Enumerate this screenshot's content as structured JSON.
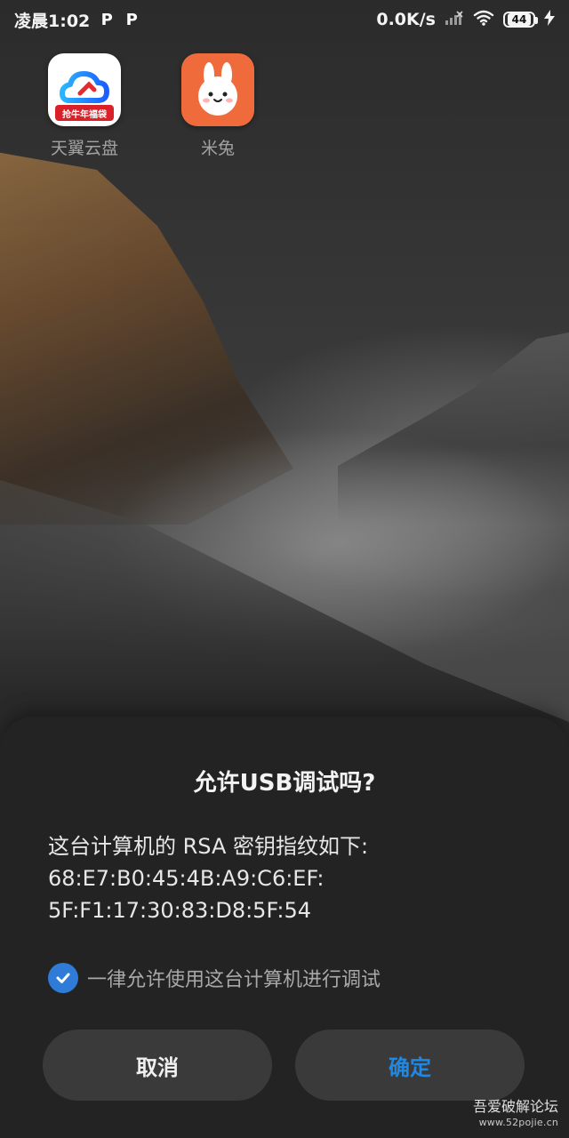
{
  "status_bar": {
    "time": "凌晨1:02",
    "left_icons": [
      "P",
      "P"
    ],
    "network_speed": "0.0K/s",
    "battery_level": "44"
  },
  "home_screen": {
    "apps": [
      {
        "label": "天翼云盘",
        "badge_text": "抢牛年福袋",
        "icon": "cloud-drive-icon"
      },
      {
        "label": "米兔",
        "icon": "bunny-icon"
      }
    ]
  },
  "dialog": {
    "title": "允许USB调试吗?",
    "body_lines": [
      "这台计算机的 RSA 密钥指纹如下:",
      "68:E7:B0:45:4B:A9:C6:EF:",
      "5F:F1:17:30:83:D8:5F:54"
    ],
    "checkbox_label": "一律允许使用这台计算机进行调试",
    "checkbox_checked": true,
    "cancel_label": "取消",
    "ok_label": "确定",
    "colors": {
      "accent": "#1e88e5",
      "check": "#2f7bd8",
      "dialog_bg": "#232323"
    }
  },
  "watermark": {
    "line1": "吾爱破解论坛",
    "line2": "www.52pojie.cn"
  }
}
